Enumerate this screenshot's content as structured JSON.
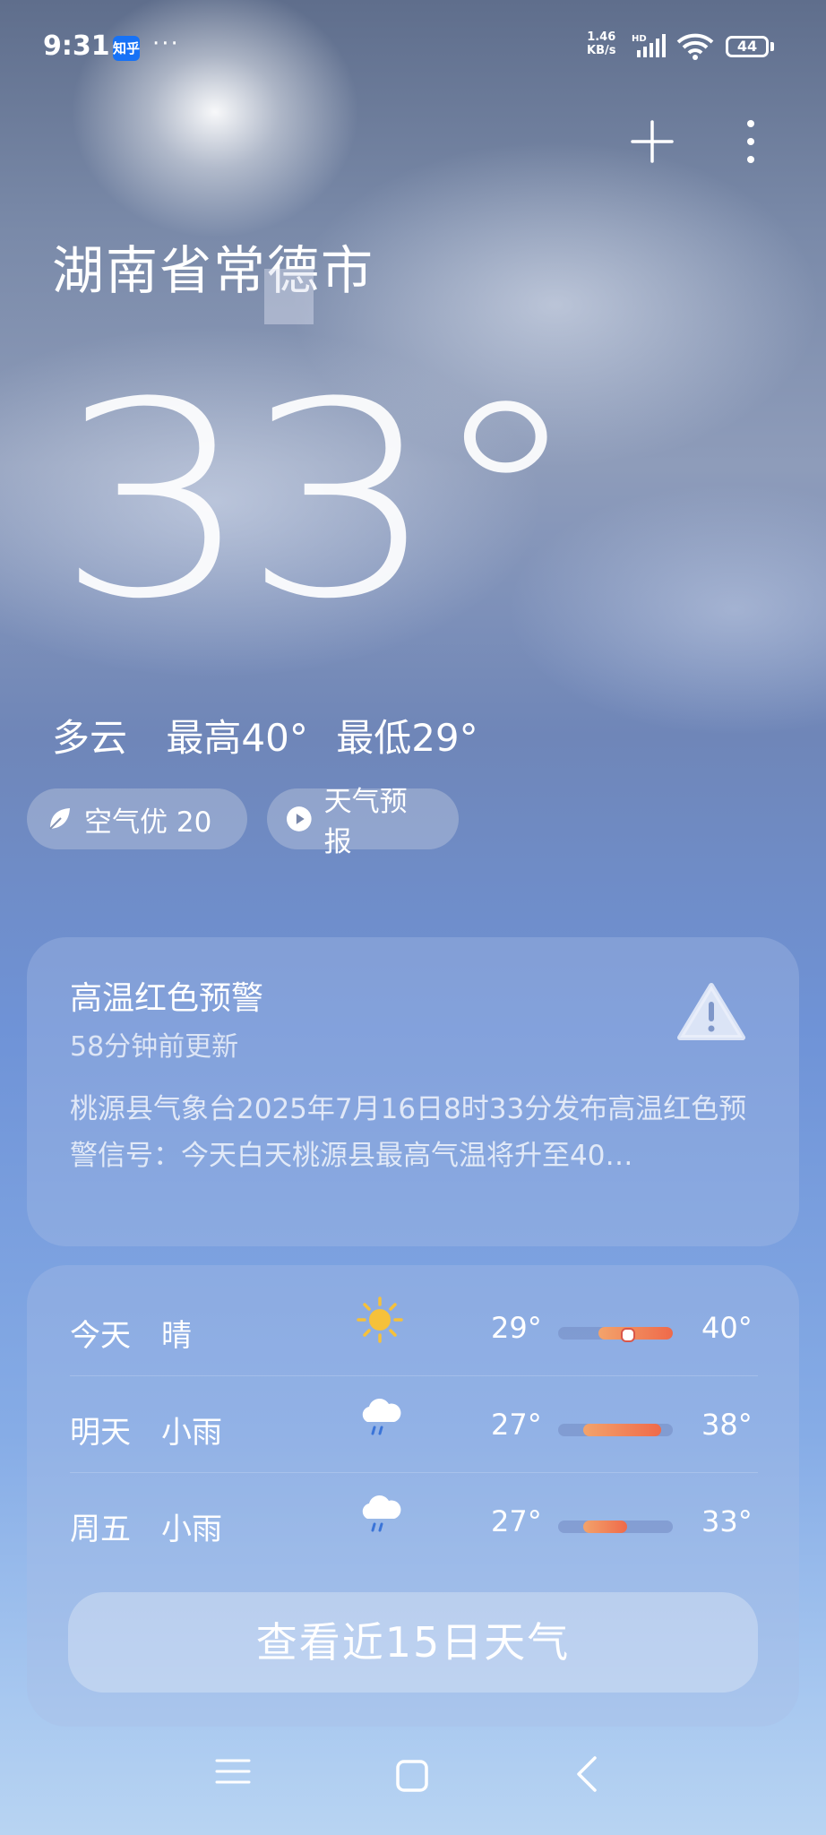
{
  "status_bar": {
    "time": "9:31",
    "app_badge": "知乎",
    "more_dots": "···",
    "net_speed_value": "1.46",
    "net_speed_unit": "KB/s",
    "network_type": "HD",
    "battery": "44"
  },
  "header": {
    "city": "湖南省常德市"
  },
  "current": {
    "temperature": "33°",
    "condition": "多云",
    "high": "最高40°",
    "low": "最低29°"
  },
  "chips": {
    "air_quality": "空气优 20",
    "forecast": "天气预报"
  },
  "alert": {
    "title": "高温红色预警",
    "updated": "58分钟前更新",
    "body": "桃源县气象台2025年7月16日8时33分发布高温红色预警信号：今天白天桃源县最高气温将升至40…"
  },
  "forecast": [
    {
      "day": "今天",
      "condition": "晴",
      "icon": "sun-icon",
      "low": "29°",
      "high": "40°",
      "range_start": 0.35,
      "range_end": 1.0,
      "current_marker": 0.6
    },
    {
      "day": "明天",
      "condition": "小雨",
      "icon": "rain-cloud-icon",
      "low": "27°",
      "high": "38°",
      "range_start": 0.22,
      "range_end": 0.9
    },
    {
      "day": "周五",
      "condition": "小雨",
      "icon": "rain-cloud-icon",
      "low": "27°",
      "high": "33°",
      "range_start": 0.22,
      "range_end": 0.6
    }
  ],
  "more_button": "查看近15日天气",
  "colors": {
    "temp_bar_warm": "#ef6a4a",
    "temp_bar_cool": "#f3a36b",
    "alert_icon": "#ffffff"
  }
}
